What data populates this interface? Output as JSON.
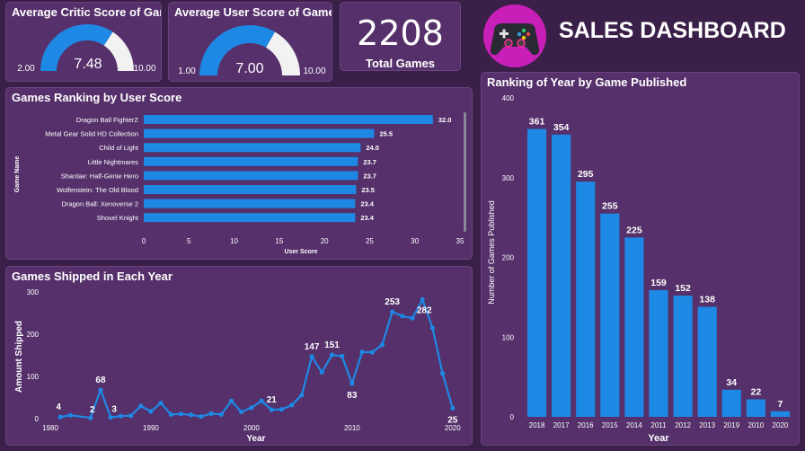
{
  "header": {
    "title": "SALES DASHBOARD",
    "icon": "gamepad-icon",
    "accent": "#1e88e5"
  },
  "kpi": {
    "total_games": "2208",
    "total_games_label": "Total Games"
  },
  "gauges": [
    {
      "title": "Average Critic Score of Games",
      "value": 7.48,
      "value_text": "7.48",
      "min_text": "2.00",
      "max_text": "10.00",
      "min": 2,
      "max": 10
    },
    {
      "title": "Average User Score of Games",
      "value": 7.0,
      "value_text": "7.00",
      "min_text": "1.00",
      "max_text": "10.00",
      "min": 1,
      "max": 10
    }
  ],
  "chart_data": [
    {
      "type": "bar",
      "orientation": "horizontal",
      "title": "Games Ranking by User Score",
      "xlabel": "User Score",
      "ylabel": "Game Name",
      "categories": [
        "Dragon Ball FighterZ",
        "Metal Gear Solid HD Collection",
        "Child of Light",
        "Little Nightmares",
        "Shantae: Half-Genie Hero",
        "Wolfenstein: The Old Blood",
        "Dragon Ball: Xenoverse 2",
        "Shovel Knight"
      ],
      "values": [
        32.0,
        25.5,
        24.0,
        23.7,
        23.7,
        23.5,
        23.4,
        23.4
      ],
      "data_labels": [
        "32.0",
        "25.5",
        "24.0",
        "23.7",
        "23.7",
        "23.5",
        "23.4",
        "23.4"
      ],
      "xlim": [
        0,
        35
      ],
      "xticks": [
        "0",
        "5",
        "10",
        "15",
        "20",
        "25",
        "30",
        "35"
      ],
      "color": "#1e88e5"
    },
    {
      "type": "line",
      "title": "Games Shipped in Each Year",
      "xlabel": "Year",
      "ylabel": "Amount Shipped",
      "x": [
        1981,
        1982,
        1984,
        1985,
        1986,
        1987,
        1988,
        1989,
        1990,
        1991,
        1992,
        1993,
        1994,
        1995,
        1996,
        1997,
        1998,
        1999,
        2000,
        2001,
        2002,
        2003,
        2004,
        2005,
        2006,
        2007,
        2008,
        2009,
        2010,
        2011,
        2012,
        2013,
        2014,
        2015,
        2016,
        2017,
        2018,
        2019,
        2020
      ],
      "y": [
        4,
        8,
        2,
        68,
        3,
        6,
        7,
        30,
        17,
        37,
        10,
        11,
        9,
        5,
        12,
        10,
        42,
        16,
        26,
        42,
        21,
        22,
        32,
        56,
        147,
        110,
        151,
        148,
        83,
        158,
        157,
        175,
        253,
        243,
        238,
        282,
        215,
        107,
        25
      ],
      "point_labels": [
        {
          "year": 1981,
          "text": "4"
        },
        {
          "year": 1984,
          "text": "2"
        },
        {
          "year": 1985,
          "text": "68"
        },
        {
          "year": 1986,
          "text": "3"
        },
        {
          "year": 2002,
          "text": "21"
        },
        {
          "year": 2006,
          "text": "147"
        },
        {
          "year": 2008,
          "text": "151"
        },
        {
          "year": 2010,
          "text": "83"
        },
        {
          "year": 2014,
          "text": "253"
        },
        {
          "year": 2017,
          "text": "282"
        },
        {
          "year": 2020,
          "text": "25"
        }
      ],
      "xlim": [
        1980,
        2021
      ],
      "xticks": [
        "1980",
        "1990",
        "2000",
        "2010",
        "2020"
      ],
      "ylim": [
        0,
        300
      ],
      "yticks": [
        "0",
        "100",
        "200",
        "300"
      ],
      "color": "#1e88e5"
    },
    {
      "type": "bar",
      "title": "Ranking of Year by Game Published",
      "xlabel": "Year",
      "ylabel": "Number of Games Published",
      "categories": [
        "2018",
        "2017",
        "2016",
        "2015",
        "2014",
        "2011",
        "2012",
        "2013",
        "2019",
        "2010",
        "2020"
      ],
      "values": [
        361,
        354,
        295,
        255,
        225,
        159,
        152,
        138,
        34,
        22,
        7
      ],
      "ylim": [
        0,
        400
      ],
      "yticks": [
        "0",
        "100",
        "200",
        "300",
        "400"
      ],
      "color": "#1e88e5"
    }
  ]
}
